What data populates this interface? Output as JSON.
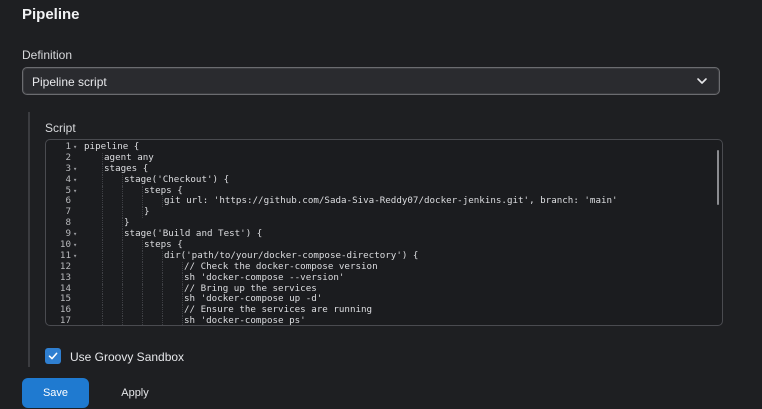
{
  "section": {
    "title": "Pipeline"
  },
  "definition": {
    "label": "Definition",
    "selected": "Pipeline script"
  },
  "script": {
    "label": "Script",
    "lines": [
      {
        "num": "1",
        "fold": true,
        "indent": 0,
        "text": "pipeline {"
      },
      {
        "num": "2",
        "fold": false,
        "indent": 1,
        "text": "agent any"
      },
      {
        "num": "3",
        "fold": true,
        "indent": 1,
        "text": "stages {"
      },
      {
        "num": "4",
        "fold": true,
        "indent": 2,
        "text": "stage('Checkout') {"
      },
      {
        "num": "5",
        "fold": true,
        "indent": 3,
        "text": "steps {"
      },
      {
        "num": "6",
        "fold": false,
        "indent": 4,
        "text": "git url: 'https://github.com/Sada-Siva-Reddy07/docker-jenkins.git', branch: 'main'"
      },
      {
        "num": "7",
        "fold": false,
        "indent": 3,
        "text": "}"
      },
      {
        "num": "8",
        "fold": false,
        "indent": 2,
        "text": "}"
      },
      {
        "num": "9",
        "fold": true,
        "indent": 2,
        "text": "stage('Build and Test') {"
      },
      {
        "num": "10",
        "fold": true,
        "indent": 3,
        "text": "steps {"
      },
      {
        "num": "11",
        "fold": true,
        "indent": 4,
        "text": "dir('path/to/your/docker-compose-directory') {"
      },
      {
        "num": "12",
        "fold": false,
        "indent": 5,
        "text": "// Check the docker-compose version"
      },
      {
        "num": "13",
        "fold": false,
        "indent": 5,
        "text": "sh 'docker-compose --version'"
      },
      {
        "num": "14",
        "fold": false,
        "indent": 5,
        "text": "// Bring up the services"
      },
      {
        "num": "15",
        "fold": false,
        "indent": 5,
        "text": "sh 'docker-compose up -d'"
      },
      {
        "num": "16",
        "fold": false,
        "indent": 5,
        "text": "// Ensure the services are running"
      },
      {
        "num": "17",
        "fold": false,
        "indent": 5,
        "text": "sh 'docker-compose ps'"
      }
    ]
  },
  "sandbox": {
    "label": "Use Groovy Sandbox",
    "checked": true
  },
  "buttons": {
    "save": "Save",
    "apply": "Apply"
  },
  "colors": {
    "accent": "#1f7ad0",
    "background": "#1e1f22"
  }
}
